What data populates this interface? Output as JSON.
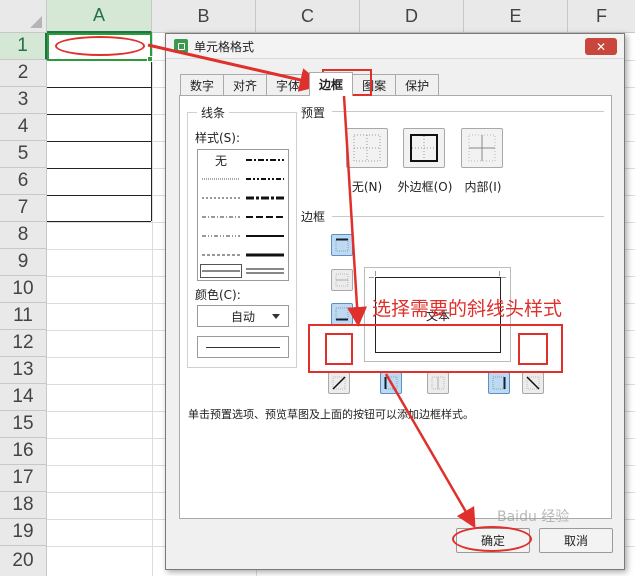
{
  "sheet": {
    "columns": [
      "A",
      "B",
      "C",
      "D",
      "E",
      "F"
    ],
    "rows": [
      "1",
      "2",
      "3",
      "4",
      "5",
      "6",
      "7",
      "8",
      "9",
      "10",
      "11",
      "12",
      "13",
      "14",
      "15",
      "16",
      "17",
      "18",
      "19",
      "20"
    ],
    "active_column": "A",
    "active_row": "1"
  },
  "dialog": {
    "title": "单元格格式",
    "close_symbol": "✕",
    "tabs": [
      "数字",
      "对齐",
      "字体",
      "边框",
      "图案",
      "保护"
    ],
    "active_tab": "边框",
    "line_group": "线条",
    "style_label": "样式(S):",
    "style_none": "无",
    "color_label": "颜色(C):",
    "color_value": "自动",
    "preset_group": "预置",
    "presets": [
      {
        "label": "无(N)",
        "icon": "border-none-icon"
      },
      {
        "label": "外边框(O)",
        "icon": "border-outline-icon"
      },
      {
        "label": "内部(I)",
        "icon": "border-inside-icon"
      }
    ],
    "border_group": "边框",
    "preview_text": "文本",
    "hint": "单击预置选项、预览草图及上面的按钮可以添加边框样式。",
    "ok_label": "确定",
    "cancel_label": "取消"
  },
  "annotation": {
    "text": "选择需要的斜线头样式",
    "color": "#e0302c"
  },
  "watermark": "Baidu 经验",
  "colors": {
    "selection_green": "#2e9b3a",
    "header_active_bg": "#d5e7d5",
    "close_red": "#c9463d",
    "button_blue": "#bfd9f2"
  }
}
